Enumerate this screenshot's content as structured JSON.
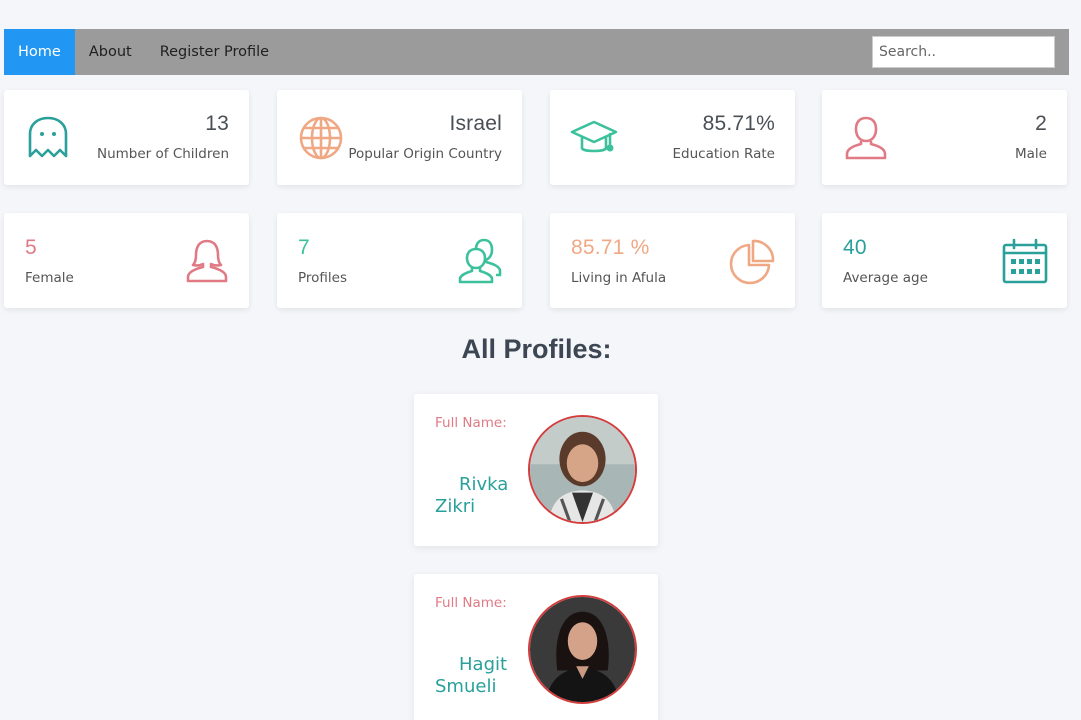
{
  "nav": {
    "items": [
      {
        "label": "Home",
        "active": true
      },
      {
        "label": "About",
        "active": false
      },
      {
        "label": "Register Profile",
        "active": false
      }
    ],
    "search_placeholder": "Search.."
  },
  "stats": [
    {
      "value": "13",
      "label": "Number of Children",
      "icon": "ghost-icon",
      "color": "#2aa09a"
    },
    {
      "value": "Israel",
      "label": "Popular Origin Country",
      "icon": "globe-icon",
      "color": "#f0a884"
    },
    {
      "value": "85.71%",
      "label": "Education Rate",
      "icon": "graduation-cap-icon",
      "color": "#3cc19c"
    },
    {
      "value": "2",
      "label": "Male",
      "icon": "user-icon",
      "color": "#e07a85"
    },
    {
      "value": "5",
      "label": "Female",
      "icon": "female-user-icon",
      "color": "#e07a85"
    },
    {
      "value": "7",
      "label": "Profiles",
      "icon": "users-icon",
      "color": "#3cc19c"
    },
    {
      "value": "85.71 %",
      "label": "Living in Afula",
      "icon": "pie-chart-icon",
      "color": "#f0a884"
    },
    {
      "value": "40",
      "label": "Average age",
      "icon": "calendar-icon",
      "color": "#2aa09a"
    }
  ],
  "section_title": "All Profiles:",
  "profiles": [
    {
      "label": "Full Name:",
      "name": "Rivka Zikri"
    },
    {
      "label": "Full Name:",
      "name": "Hagit Smueli"
    }
  ]
}
